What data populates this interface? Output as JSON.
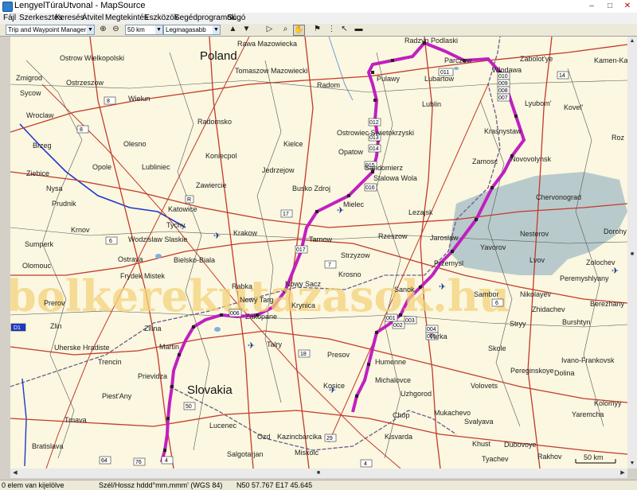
{
  "window": {
    "title": "LengyelTúraUtvonal - MapSource"
  },
  "menu": {
    "items": [
      "Fájl",
      "Szerkesztés",
      "Keresés",
      "Átvitel",
      "Megtekintés",
      "Eszközök",
      "Segédprogramok",
      "Súgó"
    ]
  },
  "toolbar": {
    "product": "Trip and Waypoint Manager v5",
    "zoom": "50 km",
    "detail": "Legmagasabb"
  },
  "map": {
    "watermark": "bolkerekutazasok.hu",
    "scale_label": "50 km",
    "country_labels": [
      "Poland",
      "Slovakia"
    ],
    "cities": [
      "Rawa Mazowiecka",
      "Radzyn Podlaski",
      "Ostrow Wielkopolski",
      "Tomaszow Mazowiecki",
      "Parczew",
      "Wlodawa",
      "Zabolot'ye",
      "Kamen-Kas",
      "Zmigrod",
      "Ostrzeszow",
      "Pulawy",
      "Lubartow",
      "Sycow",
      "Radom",
      "Lublin",
      "Kovel'",
      "Wielun",
      "Lyubom'",
      "Wroclaw",
      "Radomsko",
      "Krasnystaw",
      "Ostrowiec Swietokrzyski",
      "Brzeg",
      "Olesno",
      "Kielce",
      "Opatow",
      "Roz",
      "Koniecpol",
      "Novovolynsk",
      "Ziebice",
      "Opole",
      "Lubliniec",
      "Jedrzejow",
      "Sandomierz",
      "Zamosc",
      "Nysa",
      "Zawiercie",
      "Busko Zdroj",
      "Stalowa Wola",
      "Chervonograd",
      "Prudnik",
      "Katowice",
      "Mielec",
      "Lezajsk",
      "Tychy",
      "Krnov",
      "Krakow",
      "Rzeszow",
      "Nesterov",
      "Dorohy",
      "Wodzislaw Slaskie",
      "Tarnow",
      "Jaroslaw",
      "Sumperk",
      "Bielsko-Biala",
      "Yavorov",
      "Lvov",
      "Ostrava",
      "Strzyzow",
      "Przemysl",
      "Zolochev",
      "Olomouc",
      "Frydek Mistek",
      "Krosno",
      "Peremyshlyany",
      "Rabka",
      "Nowy Sacz",
      "Sanok",
      "Prerov",
      "Nowy Targ",
      "Sambor",
      "Nikolayev",
      "Zakopane",
      "Krynica",
      "Zhidachev",
      "Berezhany",
      "Zlin",
      "Zilina",
      "Stryy",
      "Burshtyn",
      "Uherske Hradiste",
      "Turka",
      "Martin",
      "Presov",
      "Skole",
      "Ivano-Frankovsk",
      "Trencin",
      "Humenne",
      "Dolina",
      "Prievidza",
      "Michalovce",
      "Pereginskoye",
      "Piest'Any",
      "Kosice",
      "Uzhgorod",
      "Volovets",
      "Kolomyy",
      "Trnava",
      "Mukachevo",
      "Yaremcha",
      "Bratislava",
      "Lucenec",
      "Chop",
      "Svalyava",
      "Ozd",
      "Kazincbarcika",
      "Kisvarda",
      "Khust",
      "Dubovoye",
      "Salgotarjan",
      "Miskolc",
      "Tyachev",
      "Rakhov",
      "Talry"
    ],
    "road_numbers": [
      "8",
      "8",
      "14",
      "17",
      "4",
      "4",
      "6",
      "7",
      "6",
      "76",
      "64",
      "50",
      "18",
      "29",
      "R",
      "D1"
    ],
    "waypoints": [
      "001",
      "002",
      "003",
      "004",
      "005",
      "006",
      "007",
      "008",
      "009",
      "010",
      "011",
      "012",
      "013",
      "014",
      "015",
      "016",
      "017"
    ]
  },
  "statusbar": {
    "selection": "0 elem van kijelölve",
    "coord_format": "Szél/Hossz hddd°mm.mmm' (WGS 84)",
    "coordinates": "N50 57.767 E17 45.645"
  }
}
